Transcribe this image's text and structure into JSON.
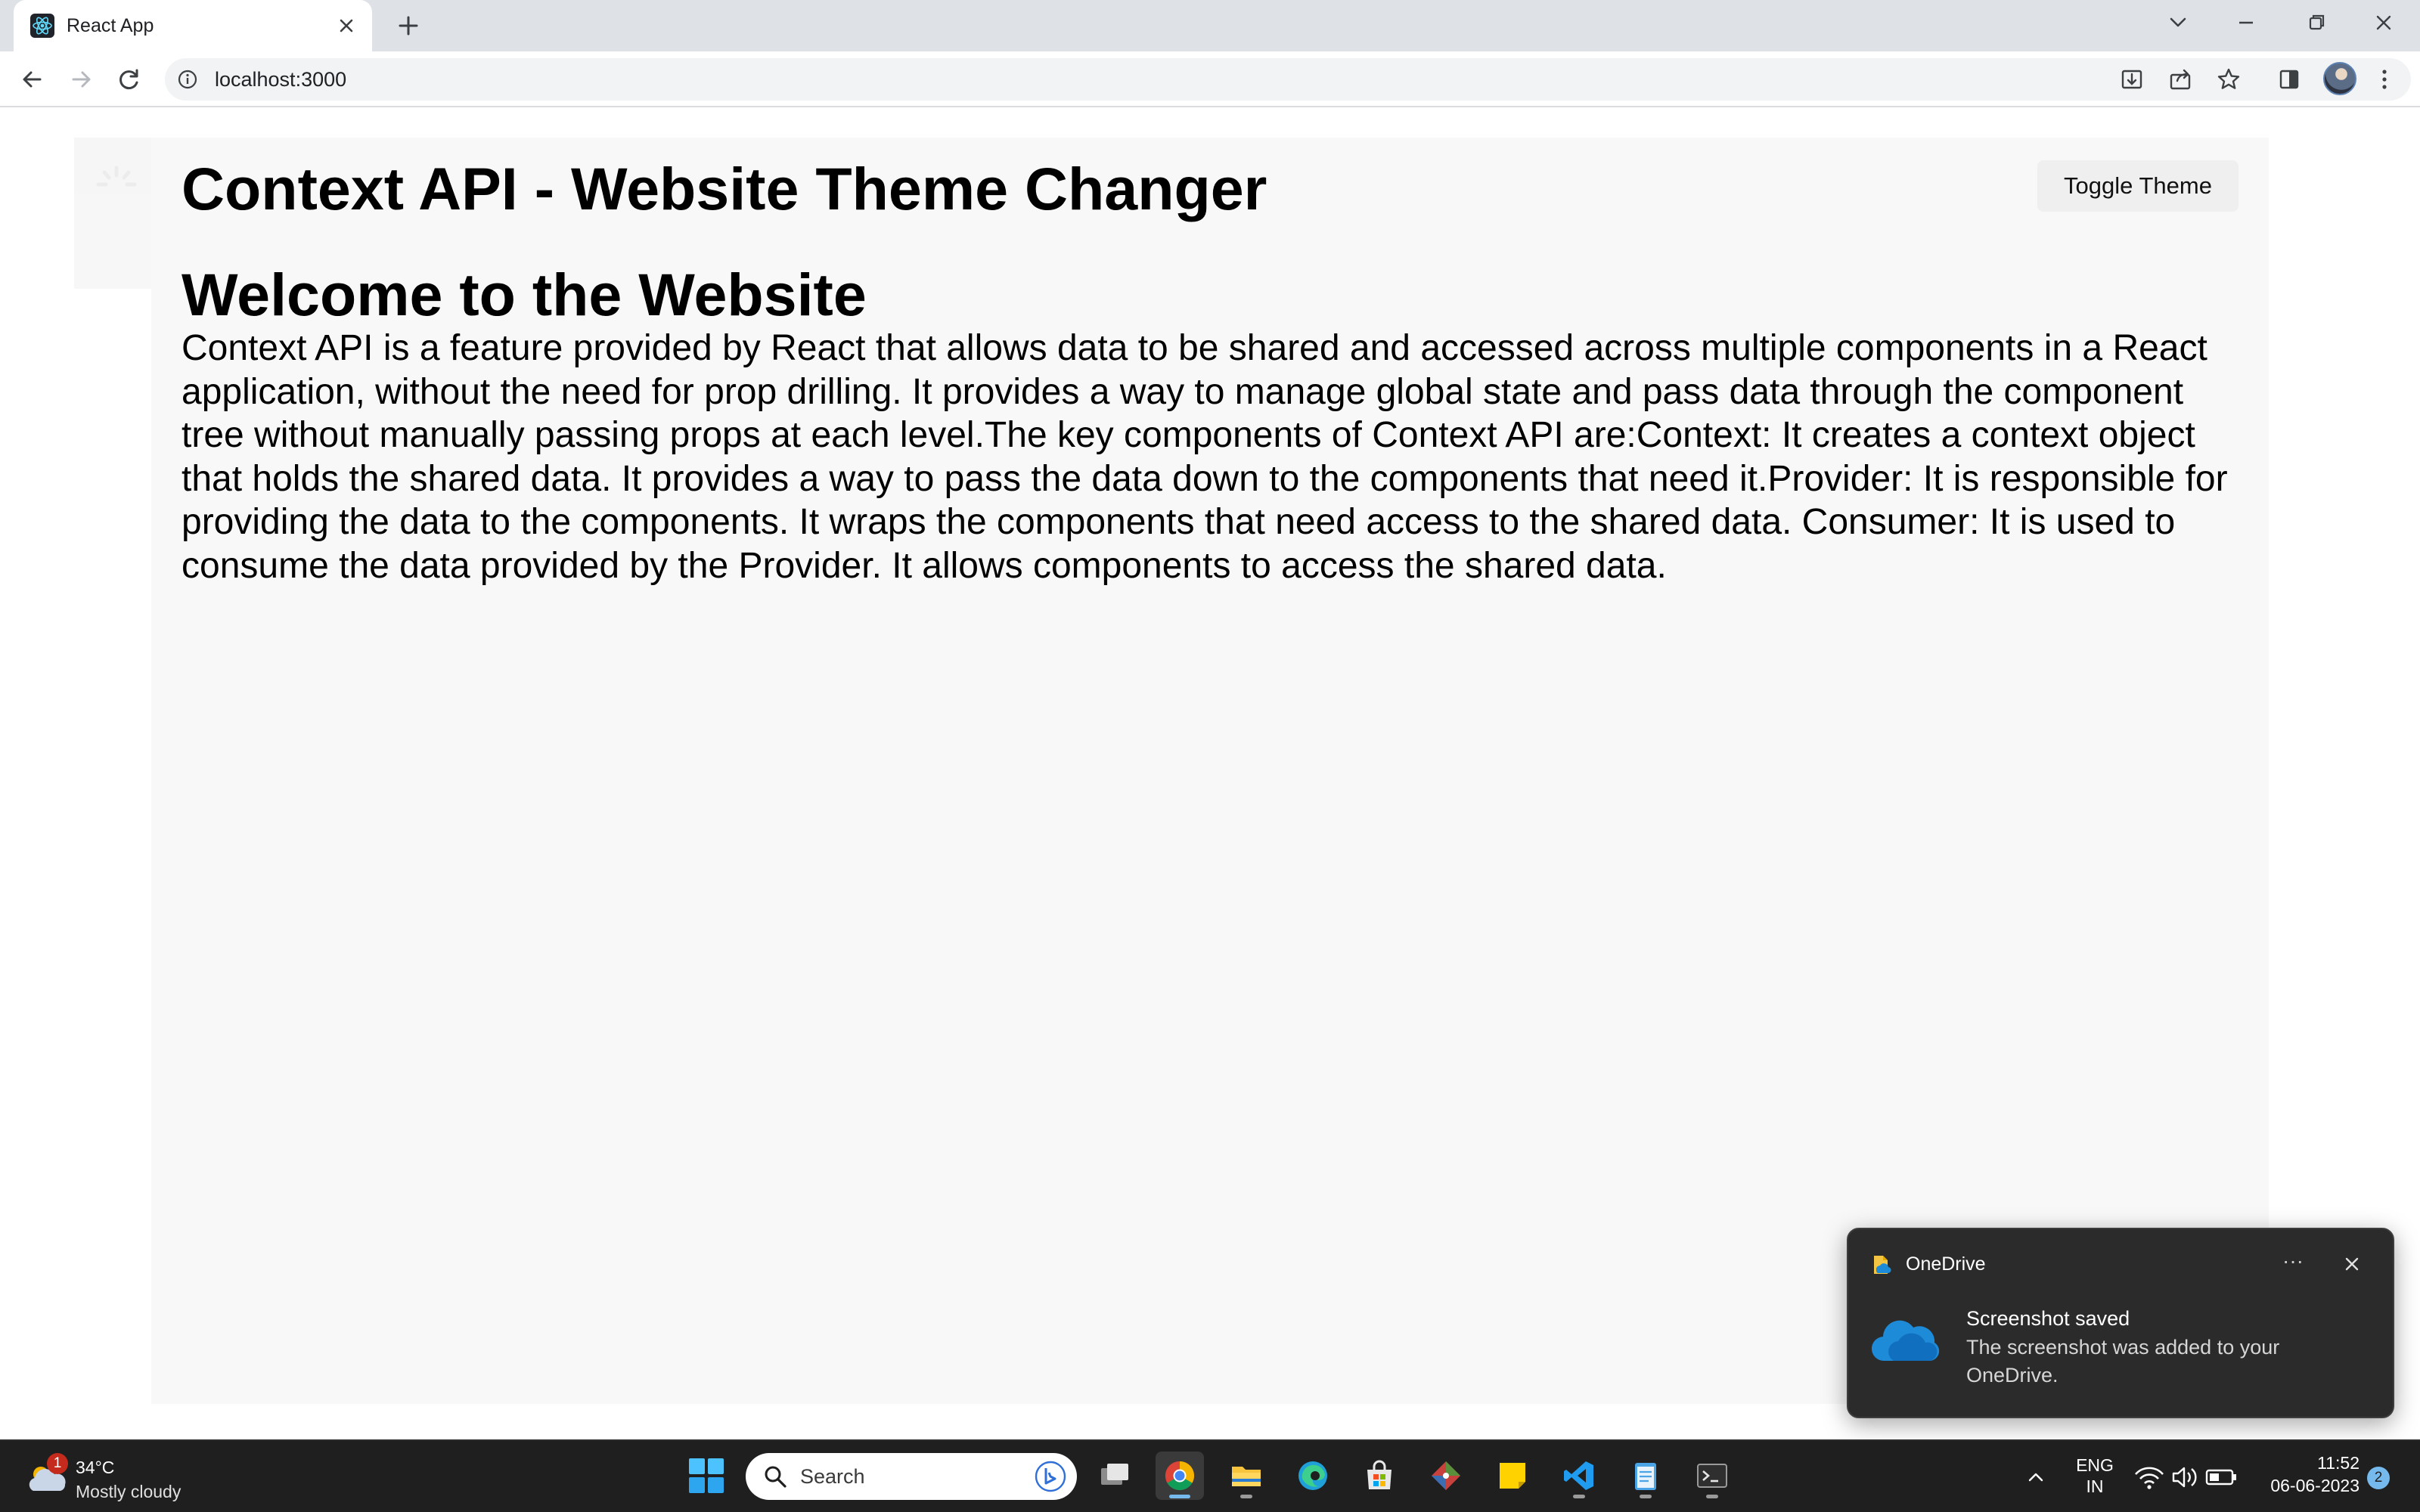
{
  "browser": {
    "tab_title": "React App",
    "url": "localhost:3000",
    "icons": {
      "tab_favicon": "react-logo-icon",
      "tab_close": "close-icon",
      "new_tab": "plus-icon",
      "tab_search": "chevron-down-icon",
      "back": "arrow-left-icon",
      "forward": "arrow-right-icon",
      "reload": "reload-icon",
      "site_info": "info-icon",
      "install": "install-icon",
      "share": "share-icon",
      "bookmark": "star-icon",
      "side_panel": "side-panel-icon",
      "menu": "kebab-menu-icon"
    }
  },
  "page": {
    "header_title": "Context API - Website Theme Changer",
    "toggle_button": "Toggle Theme",
    "welcome_heading": "Welcome to the Website",
    "body_text": "Context API is a feature provided by React that allows data to be shared and accessed across multiple components in a React application, without the need for prop drilling. It provides a way to manage global state and pass data through the component tree without manually passing props at each level.The key components of Context API are:Context: It creates a context object that holds the shared data. It provides a way to pass the data down to the components that need it.Provider: It is responsible for providing the data to the components. It wraps the components that need access to the shared data. Consumer: It is used to consume the data provided by the Provider. It allows components to access the shared data.",
    "colors": {
      "container_bg": "#f8f8f8",
      "button_bg": "#efefef",
      "text": "#000000"
    }
  },
  "toast": {
    "app_name": "OneDrive",
    "title": "Screenshot saved",
    "body": "The screenshot was added to your OneDrive.",
    "more_label": "···"
  },
  "taskbar": {
    "weather": {
      "temp": "34°C",
      "condition": "Mostly cloudy",
      "badge": "1"
    },
    "search_placeholder": "Search",
    "apps": [
      "task-view",
      "chrome",
      "file-explorer",
      "edge",
      "microsoft-store",
      "git",
      "sticky-notes",
      "vscode",
      "notepad",
      "terminal"
    ],
    "language": {
      "line1": "ENG",
      "line2": "IN"
    },
    "clock": {
      "time": "11:52",
      "date": "06-06-2023"
    },
    "notification_count": "2"
  }
}
